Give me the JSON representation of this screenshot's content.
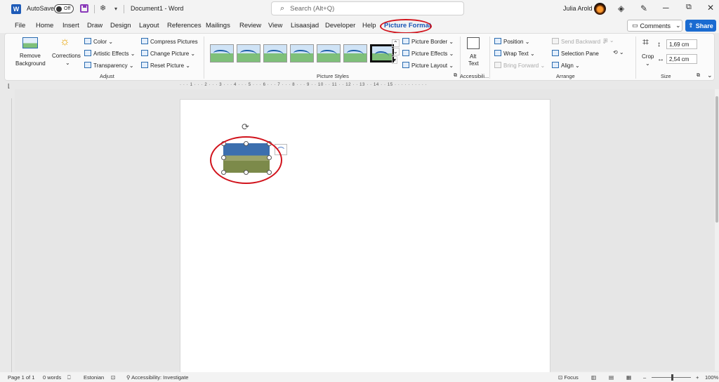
{
  "titlebar": {
    "app_letter": "W",
    "autosave_label": "AutoSave",
    "autosave_state": "Off",
    "document_title": "Document1  -  Word",
    "search_placeholder": "Search (Alt+Q)",
    "user_name": "Julia Arold"
  },
  "menu": {
    "items": [
      "File",
      "Home",
      "Insert",
      "Draw",
      "Design",
      "Layout",
      "References",
      "Mailings",
      "Review",
      "View",
      "Lisaasjad",
      "Developer",
      "Help",
      "Picture Format"
    ],
    "active": "Picture Format",
    "comments_label": "Comments",
    "share_label": "Share"
  },
  "ribbon": {
    "adjust": {
      "remove_background_1": "Remove",
      "remove_background_2": "Background",
      "corrections": "Corrections",
      "color": "Color",
      "artistic_effects": "Artistic Effects",
      "transparency": "Transparency",
      "compress_pictures": "Compress Pictures",
      "change_picture": "Change Picture",
      "reset_picture": "Reset Picture",
      "group_label": "Adjust"
    },
    "picture_styles": {
      "picture_border": "Picture Border",
      "picture_effects": "Picture Effects",
      "picture_layout": "Picture Layout",
      "group_label": "Picture Styles"
    },
    "accessibility": {
      "alt_text_1": "Alt",
      "alt_text_2": "Text",
      "group_label": "Accessibili..."
    },
    "arrange": {
      "position": "Position",
      "wrap_text": "Wrap Text",
      "bring_forward": "Bring Forward",
      "send_backward": "Send Backward",
      "selection_pane": "Selection Pane",
      "align": "Align",
      "group_label": "Arrange"
    },
    "size": {
      "crop": "Crop",
      "height": "1,69 cm",
      "width": "2,54 cm",
      "group_label": "Size"
    }
  },
  "ruler": {
    "horizontal_text": "· · · 1 · · · 2 · · · 3 · · · 4 · · · 5 · · · 6 · · · 7 · · · 8 · · · 9 · · 10 · · 11 · · 12 · · 13 · · 14 · · 15 · · · · · · · · · ·"
  },
  "statusbar": {
    "page": "Page 1 of 1",
    "words": "0 words",
    "language": "Estonian",
    "accessibility": "Accessibility: Investigate",
    "focus": "Focus",
    "zoom": "100%"
  },
  "colors": {
    "accent": "#1a55b5",
    "share_button": "#1a6bd1",
    "annotation_red": "#d1131c",
    "save_icon": "#8a3ab9"
  }
}
